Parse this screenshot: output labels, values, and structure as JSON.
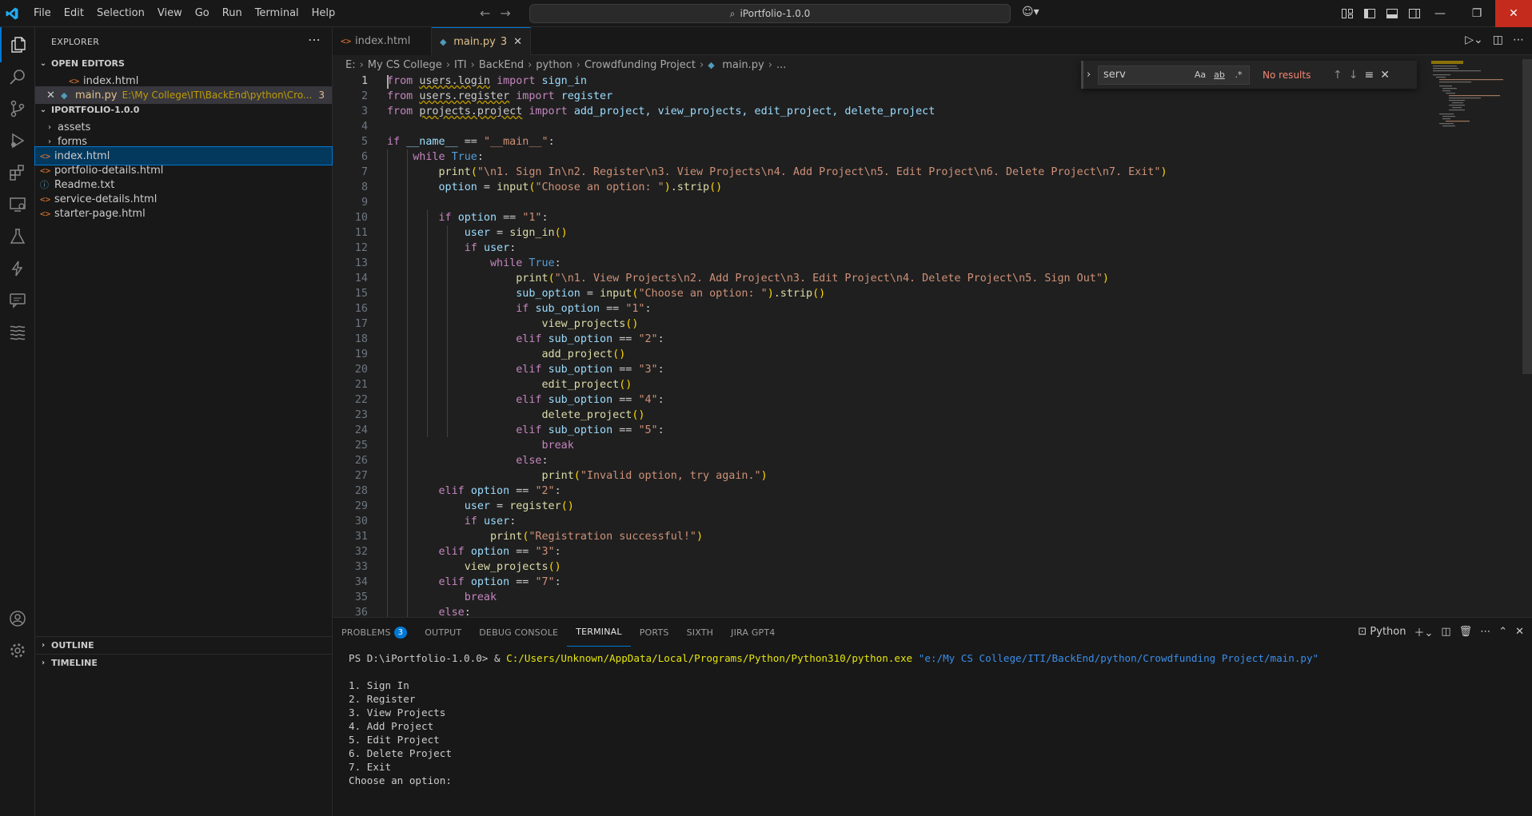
{
  "menu": [
    "File",
    "Edit",
    "Selection",
    "View",
    "Go",
    "Run",
    "Terminal",
    "Help"
  ],
  "command_center": "iPortfolio-1.0.0",
  "explorer": {
    "title": "EXPLORER",
    "open_editors_label": "OPEN EDITORS",
    "open_editors": [
      {
        "name": "index.html"
      },
      {
        "name": "main.py",
        "path": "E:\\My College\\ITI\\BackEnd\\python\\Cro...",
        "problems": "3"
      }
    ],
    "project_label": "IPORTFOLIO-1.0.0",
    "tree": [
      {
        "name": "assets",
        "type": "folder"
      },
      {
        "name": "forms",
        "type": "folder"
      },
      {
        "name": "index.html",
        "type": "html"
      },
      {
        "name": "portfolio-details.html",
        "type": "html"
      },
      {
        "name": "Readme.txt",
        "type": "info"
      },
      {
        "name": "service-details.html",
        "type": "html"
      },
      {
        "name": "starter-page.html",
        "type": "html"
      }
    ],
    "outline_label": "OUTLINE",
    "timeline_label": "TIMELINE"
  },
  "tabs": [
    {
      "label": "index.html"
    },
    {
      "label": "main.py",
      "problems": "3"
    }
  ],
  "breadcrumb": [
    "E:",
    "My CS College",
    "ITI",
    "BackEnd",
    "python",
    "Crowdfunding Project",
    "main.py",
    "..."
  ],
  "find": {
    "value": "serv",
    "result": "No results",
    "opt_case": "Aa",
    "opt_word": "ab",
    "opt_regex": ".*"
  },
  "code_lines": [
    "1",
    "2",
    "3",
    "4",
    "5",
    "6",
    "7",
    "8",
    "9",
    "10",
    "11",
    "12",
    "13",
    "14",
    "15",
    "16",
    "17",
    "18",
    "19",
    "20",
    "21",
    "22",
    "23",
    "24",
    "25",
    "26",
    "27",
    "28",
    "29",
    "30",
    "31",
    "32",
    "33",
    "34",
    "35",
    "36"
  ],
  "code": {
    "l1a": "from",
    "l1b": "users.login",
    "l1c": "import",
    "l1d": "sign_in",
    "l2a": "from",
    "l2b": "users.register",
    "l2c": "import",
    "l2d": "register",
    "l3a": "from",
    "l3b": "projects.project",
    "l3c": "import",
    "l3d": "add_project, view_projects, edit_project, delete_project",
    "l5a": "if",
    "l5b": "__name__",
    "l5c": " == ",
    "l5d": "\"__main__\"",
    "l5e": ":",
    "l6a": "while",
    "l6b": "True",
    "l6c": ":",
    "l7a": "print",
    "l7b": "\"\\n1. Sign In\\n2. Register\\n3. View Projects\\n4. Add Project\\n5. Edit Project\\n6. Delete Project\\n7. Exit\"",
    "l8a": "option",
    "l8b": " = ",
    "l8c": "input",
    "l8d": "\"Choose an option: \"",
    "l8e": ".strip",
    "l10a": "if",
    "l10b": "option",
    "l10c": " == ",
    "l10d": "\"1\"",
    "l10e": ":",
    "l11a": "user",
    "l11b": " = ",
    "l11c": "sign_in",
    "l12a": "if",
    "l12b": "user",
    "l12c": ":",
    "l13a": "while",
    "l13b": "True",
    "l13c": ":",
    "l14a": "print",
    "l14b": "\"\\n1. View Projects\\n2. Add Project\\n3. Edit Project\\n4. Delete Project\\n5. Sign Out\"",
    "l15a": "sub_option",
    "l15b": " = ",
    "l15c": "input",
    "l15d": "\"Choose an option: \"",
    "l15e": ".strip",
    "l16a": "if",
    "l16b": "sub_option",
    "l16c": " == ",
    "l16d": "\"1\"",
    "l16e": ":",
    "l17a": "view_projects",
    "l18a": "elif",
    "l18b": "sub_option",
    "l18c": " == ",
    "l18d": "\"2\"",
    "l18e": ":",
    "l19a": "add_project",
    "l20a": "elif",
    "l20b": "sub_option",
    "l20c": " == ",
    "l20d": "\"3\"",
    "l20e": ":",
    "l21a": "edit_project",
    "l22a": "elif",
    "l22b": "sub_option",
    "l22c": " == ",
    "l22d": "\"4\"",
    "l22e": ":",
    "l23a": "delete_project",
    "l24a": "elif",
    "l24b": "sub_option",
    "l24c": " == ",
    "l24d": "\"5\"",
    "l24e": ":",
    "l25a": "break",
    "l26a": "else",
    "l26b": ":",
    "l27a": "print",
    "l27b": "\"Invalid option, try again.\"",
    "l28a": "elif",
    "l28b": "option",
    "l28c": " == ",
    "l28d": "\"2\"",
    "l28e": ":",
    "l29a": "user",
    "l29b": " = ",
    "l29c": "register",
    "l30a": "if",
    "l30b": "user",
    "l30c": ":",
    "l31a": "print",
    "l31b": "\"Registration successful!\"",
    "l32a": "elif",
    "l32b": "option",
    "l32c": " == ",
    "l32d": "\"3\"",
    "l32e": ":",
    "l33a": "view_projects",
    "l34a": "elif",
    "l34b": "option",
    "l34c": " == ",
    "l34d": "\"7\"",
    "l34e": ":",
    "l35a": "break",
    "l36a": "else",
    "l36b": ":"
  },
  "panel": {
    "tabs": [
      "PROBLEMS",
      "OUTPUT",
      "DEBUG CONSOLE",
      "TERMINAL",
      "PORTS",
      "SIXTH",
      "JIRA GPT4"
    ],
    "problems_count": "3",
    "shell": "Python",
    "prompt": "PS D:\\iPortfolio-1.0.0> & ",
    "exe": "C:/Users/Unknown/AppData/Local/Programs/Python/Python310/python.exe",
    "script": "\"e:/My CS College/ITI/BackEnd/python/Crowdfunding Project/main.py\"",
    "output": [
      "1. Sign In",
      "2. Register",
      "3. View Projects",
      "4. Add Project",
      "5. Edit Project",
      "6. Delete Project",
      "7. Exit",
      "Choose an option:"
    ]
  }
}
